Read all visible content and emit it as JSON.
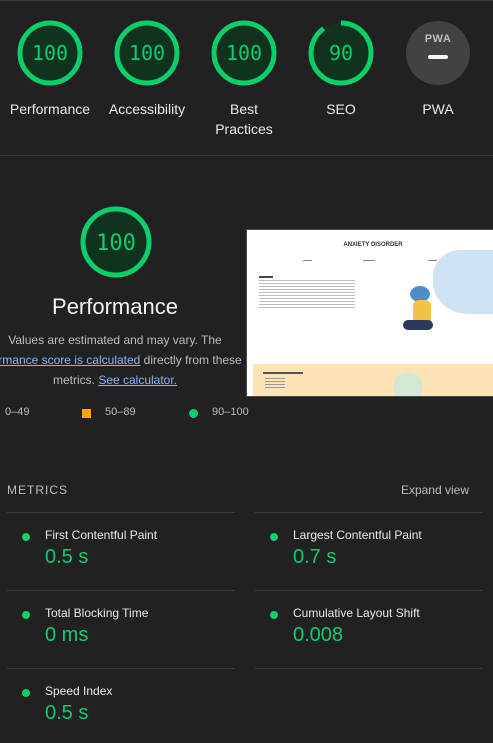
{
  "scores": [
    {
      "label": "Performance",
      "value": "100"
    },
    {
      "label": "Accessibility",
      "value": "100"
    },
    {
      "label": "Best Practices",
      "value": "100"
    },
    {
      "label": "SEO",
      "value": "90"
    },
    {
      "label": "PWA",
      "value": ""
    }
  ],
  "score_fractions": [
    1.0,
    1.0,
    1.0,
    0.9
  ],
  "pwa_badge_text": "PWA",
  "performance": {
    "score": "100",
    "title": "Performance",
    "desc_start": "Values are estimated and may vary. The",
    "desc_link": "formance score is calculated",
    "desc_mid": " directly from these",
    "desc_end_pre": "metrics. ",
    "calc_link": "See calculator."
  },
  "legend": {
    "fail": "0–49",
    "average": "50–89",
    "pass": "90–100"
  },
  "thumbnail": {
    "title": "ANXIETY DISORDER"
  },
  "metrics_header": "METRICS",
  "expand_label": "Expand view",
  "metrics": [
    {
      "name": "First Contentful Paint",
      "value": "0.5 s"
    },
    {
      "name": "Largest Contentful Paint",
      "value": "0.7 s"
    },
    {
      "name": "Total Blocking Time",
      "value": "0 ms"
    },
    {
      "name": "Cumulative Layout Shift",
      "value": "0.008"
    },
    {
      "name": "Speed Index",
      "value": "0.5 s"
    }
  ],
  "colors": {
    "pass": "#0cce6b",
    "average": "#ffa400",
    "background": "#212121",
    "link": "#8ab4f8"
  },
  "icons": {
    "pwa": "pwa-badge-icon"
  }
}
